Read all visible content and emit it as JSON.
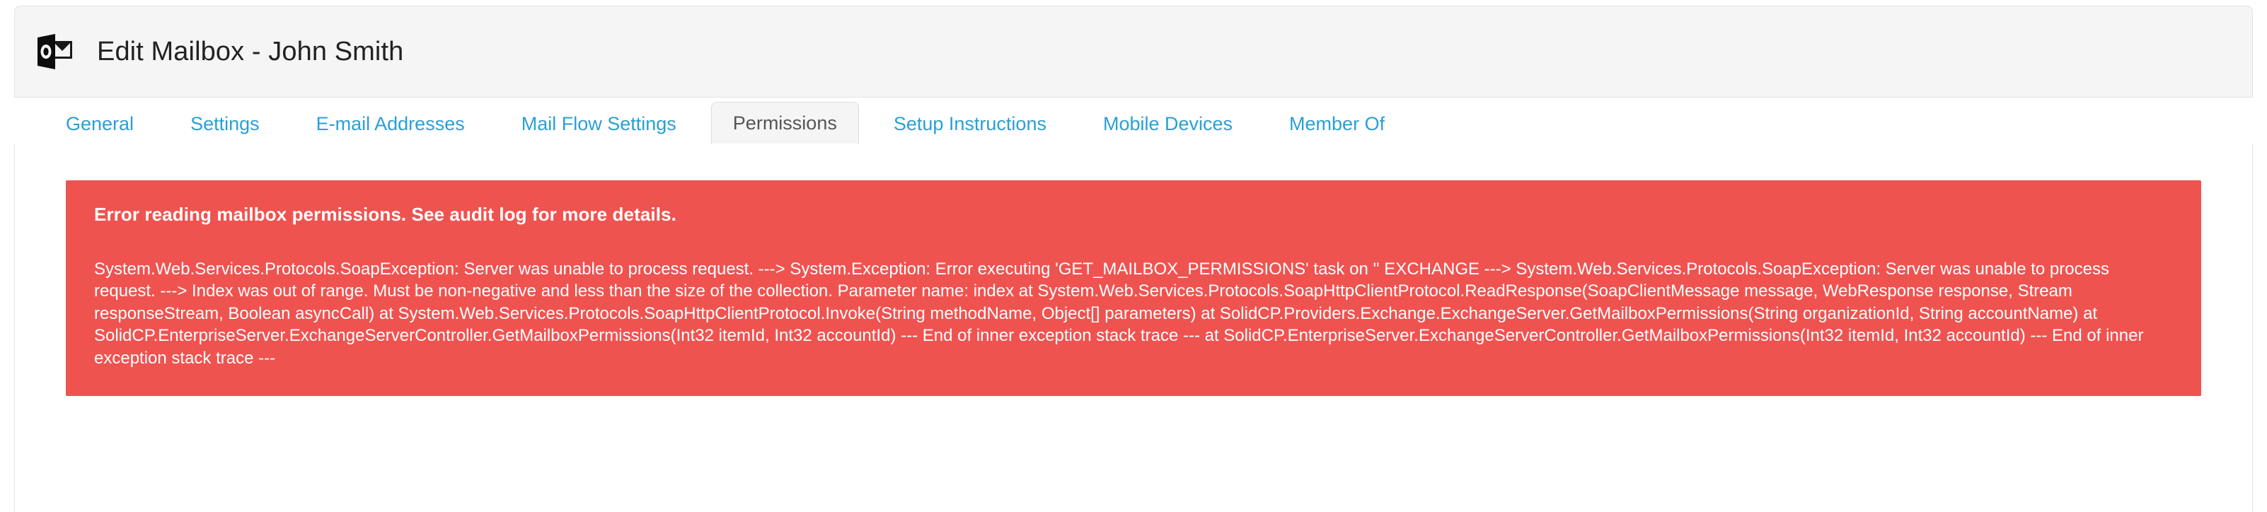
{
  "header": {
    "icon": "outlook-mailbox-icon",
    "title": "Edit Mailbox - John Smith"
  },
  "tabs": [
    {
      "label": "General",
      "active": false
    },
    {
      "label": "Settings",
      "active": false
    },
    {
      "label": "E-mail Addresses",
      "active": false
    },
    {
      "label": "Mail Flow Settings",
      "active": false
    },
    {
      "label": "Permissions",
      "active": true
    },
    {
      "label": "Setup Instructions",
      "active": false
    },
    {
      "label": "Mobile Devices",
      "active": false
    },
    {
      "label": "Member Of",
      "active": false
    }
  ],
  "alert": {
    "type": "error",
    "background_color": "#ef5350",
    "text_color": "#ffffff",
    "title": "Error reading mailbox permissions. See audit log for more details.",
    "detail": "System.Web.Services.Protocols.SoapException: Server was unable to process request. ---> System.Exception: Error executing 'GET_MAILBOX_PERMISSIONS' task on '' EXCHANGE ---> System.Web.Services.Protocols.SoapException: Server was unable to process request. ---> Index was out of range. Must be non-negative and less than the size of the collection. Parameter name: index at System.Web.Services.Protocols.SoapHttpClientProtocol.ReadResponse(SoapClientMessage message, WebResponse response, Stream responseStream, Boolean asyncCall) at System.Web.Services.Protocols.SoapHttpClientProtocol.Invoke(String methodName, Object[] parameters) at SolidCP.Providers.Exchange.ExchangeServer.GetMailboxPermissions(String organizationId, String accountName) at SolidCP.EnterpriseServer.ExchangeServerController.GetMailboxPermissions(Int32 itemId, Int32 accountId) --- End of inner exception stack trace --- at SolidCP.EnterpriseServer.ExchangeServerController.GetMailboxPermissions(Int32 itemId, Int32 accountId) --- End of inner exception stack trace ---"
  },
  "colors": {
    "tab_link": "#2a9fd6",
    "tab_active_text": "#555555",
    "header_background": "#f5f5f5",
    "error_red": "#ef5350"
  }
}
